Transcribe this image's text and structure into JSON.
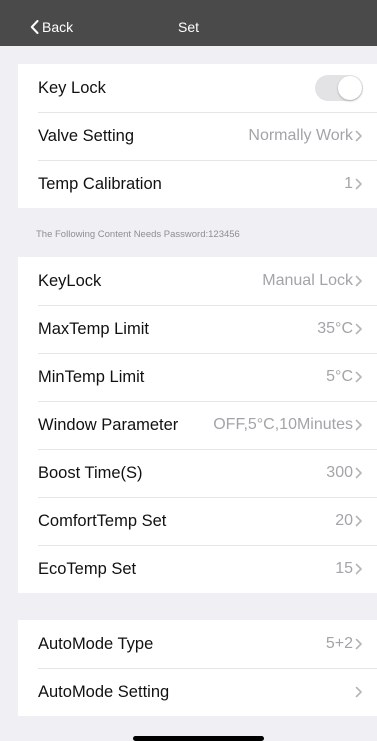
{
  "navbar": {
    "back_label": "Back",
    "title": "Set"
  },
  "group1": [
    {
      "label": "Key Lock",
      "type": "toggle",
      "on": false
    },
    {
      "label": "Valve Setting",
      "value": "Normally Work"
    },
    {
      "label": "Temp Calibration",
      "value": "1"
    }
  ],
  "password_note": "The Following Content Needs Password:123456",
  "group2": [
    {
      "label": "KeyLock",
      "value": "Manual Lock"
    },
    {
      "label": "MaxTemp Limit",
      "value": "35°C"
    },
    {
      "label": "MinTemp Limit",
      "value": "5°C"
    },
    {
      "label": "Window Parameter",
      "value": "OFF,5°C,10Minutes"
    },
    {
      "label": "Boost Time(S)",
      "value": "300"
    },
    {
      "label": "ComfortTemp Set",
      "value": "20"
    },
    {
      "label": "EcoTemp Set",
      "value": "15"
    }
  ],
  "group3": [
    {
      "label": "AutoMode Type",
      "value": "5+2"
    },
    {
      "label": "AutoMode Setting",
      "value": ""
    }
  ],
  "colors": {
    "navbar_bg": "#4a4a4a",
    "background": "#efeff4",
    "value_text": "#a4a4a8",
    "chevron": "#b5b5ba"
  },
  "icons": {
    "back": "chevron-left-icon",
    "disclosure": "chevron-right-icon"
  }
}
